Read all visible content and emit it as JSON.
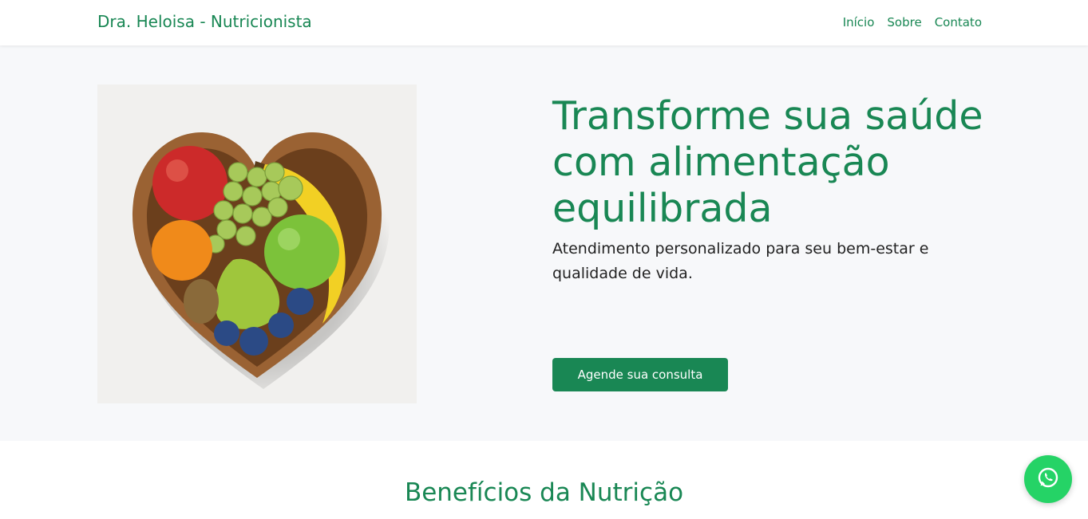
{
  "navbar": {
    "brand": "Dra. Heloisa - Nutricionista",
    "links": [
      "Início",
      "Sobre",
      "Contato"
    ]
  },
  "hero": {
    "image_alt": "heart-shaped basket of fruits",
    "title": "Transforme sua saúde com alimentação equilibrada",
    "subtitle": "Atendimento personalizado para seu bem-estar e qualidade de vida.",
    "cta_label": "Agende sua consulta"
  },
  "benefits": {
    "title": "Benefícios da Nutrição"
  },
  "floating": {
    "icon": "whatsapp-icon"
  },
  "colors": {
    "primary": "#198754",
    "hero_bg": "#f7f8fa",
    "whatsapp": "#25d366"
  }
}
